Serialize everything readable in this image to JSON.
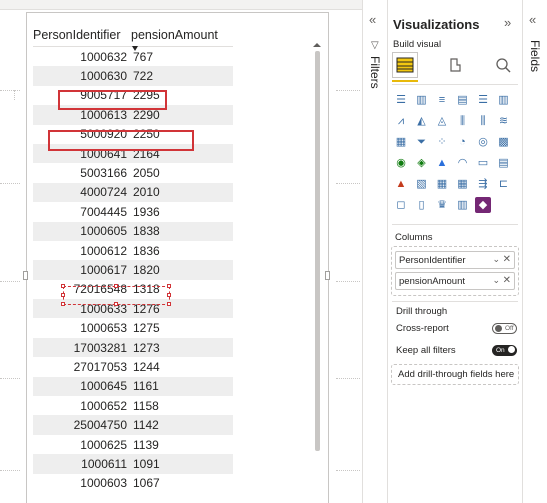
{
  "table": {
    "headers": [
      "PersonIdentifier",
      "pensionAmount"
    ],
    "rows": [
      [
        "1000632",
        "767"
      ],
      [
        "1000630",
        "722"
      ],
      [
        "9005717",
        "2295"
      ],
      [
        "1000613",
        "2290"
      ],
      [
        "5000920",
        "2250"
      ],
      [
        "1000641",
        "2164"
      ],
      [
        "5003166",
        "2050"
      ],
      [
        "4000724",
        "2010"
      ],
      [
        "7004445",
        "1936"
      ],
      [
        "1000605",
        "1838"
      ],
      [
        "1000612",
        "1836"
      ],
      [
        "1000617",
        "1820"
      ],
      [
        "72016548",
        "1318"
      ],
      [
        "1000633",
        "1276"
      ],
      [
        "1000653",
        "1275"
      ],
      [
        "17003281",
        "1273"
      ],
      [
        "27017053",
        "1244"
      ],
      [
        "1000645",
        "1161"
      ],
      [
        "1000652",
        "1158"
      ],
      [
        "25004750",
        "1142"
      ],
      [
        "1000625",
        "1139"
      ],
      [
        "1000611",
        "1091"
      ],
      [
        "1000603",
        "1067"
      ]
    ]
  },
  "filters": {
    "label": "Filters",
    "collapse_icon": "«"
  },
  "visualizations": {
    "title": "Visualizations",
    "collapse_icon": "»",
    "build_visual": "Build visual",
    "tabs": [
      "table-icon",
      "format-brush-icon",
      "analytics-icon"
    ],
    "columns_label": "Columns",
    "column_fields": [
      "PersonIdentifier",
      "pensionAmount"
    ],
    "drill_through": "Drill through",
    "cross_report": "Cross-report",
    "cross_report_state": "Off",
    "keep_all_filters": "Keep all filters",
    "keep_all_filters_state": "On",
    "add_drill": "Add drill-through fields here"
  },
  "fields_pane": {
    "label": "Fields",
    "collapse_icon": "«"
  },
  "colors": {
    "highlight_red": "#d13438",
    "accent": "#e8b90a",
    "alt_row": "#eeeeee"
  }
}
